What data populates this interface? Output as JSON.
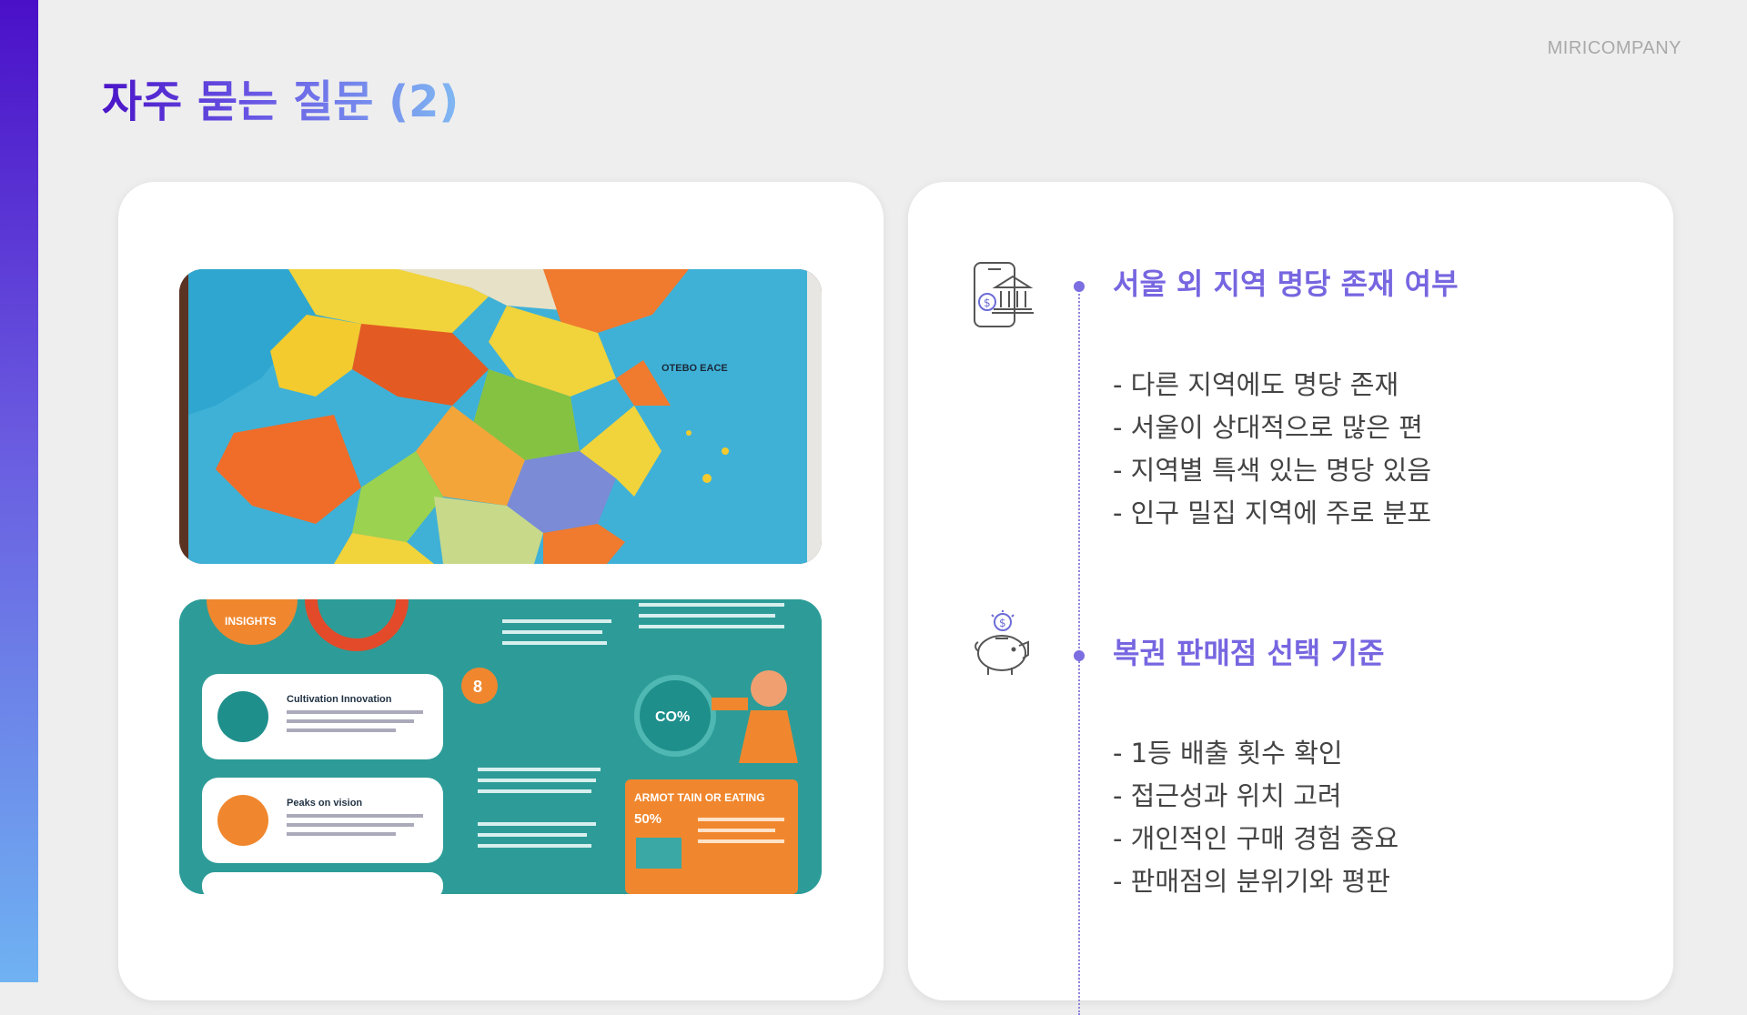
{
  "brand": "MIRICOMPANY",
  "title": "자주 묻는 질문 (2)",
  "colors": {
    "accent": "#7666e0",
    "title_gradient_start": "#4a14c8",
    "title_gradient_end": "#80b8f2"
  },
  "images": {
    "map": {
      "label": "OTEBO EACE"
    },
    "infographic": {
      "badge_top": "INSIGHTS",
      "box1_title": "Cultivation Innovation",
      "box2_title": "Peaks on vision",
      "orange_title": "ARMOT TAIN OR EATING",
      "orange_value": "50%",
      "number_badge": "8",
      "circle_label": "CO%"
    }
  },
  "sections": [
    {
      "icon": "bank-phone-icon",
      "heading": "서울 외 지역 명당 존재 여부",
      "bullets": [
        "- 다른 지역에도 명당 존재",
        "- 서울이 상대적으로 많은 편",
        "- 지역별 특색 있는 명당 있음",
        "- 인구 밀집 지역에 주로 분포"
      ]
    },
    {
      "icon": "piggy-bank-icon",
      "heading": "복권 판매점 선택 기준",
      "bullets": [
        "- 1등 배출 횟수 확인",
        "- 접근성과 위치 고려",
        "- 개인적인 구매 경험 중요",
        "- 판매점의 분위기와 평판"
      ]
    }
  ]
}
